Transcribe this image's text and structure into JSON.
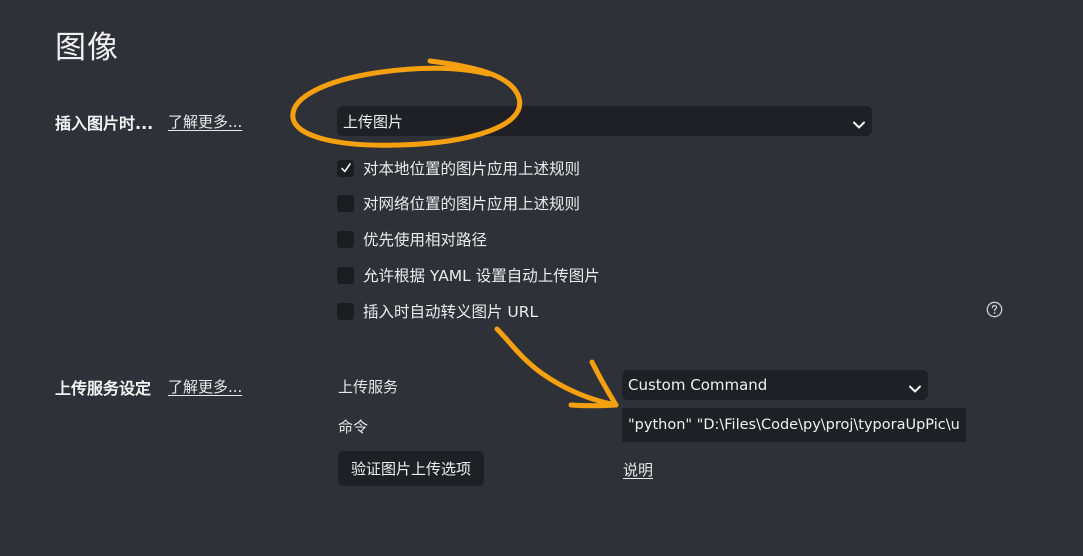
{
  "page": {
    "title": "图像"
  },
  "insert_image": {
    "label": "插入图片时...",
    "learn_more": "了解更多...",
    "select_value": "上传图片",
    "options": [
      {
        "label": "对本地位置的图片应用上述规则",
        "checked": true
      },
      {
        "label": "对网络位置的图片应用上述规则",
        "checked": false
      },
      {
        "label": "优先使用相对路径",
        "checked": false
      },
      {
        "label": "允许根据 YAML 设置自动上传图片",
        "checked": false
      },
      {
        "label": "插入时自动转义图片 URL",
        "checked": false
      }
    ],
    "help_icon": "question-circle-icon"
  },
  "upload": {
    "label": "上传服务设定",
    "learn_more": "了解更多...",
    "service_label": "上传服务",
    "service_value": "Custom Command",
    "command_label": "命令",
    "command_value": "\"python\" \"D:\\Files\\Code\\py\\proj\\typoraUpPic\\upload",
    "verify_button": "验证图片上传选项",
    "explain_link": "说明"
  },
  "annotations": {
    "color": "#f5a10f"
  }
}
